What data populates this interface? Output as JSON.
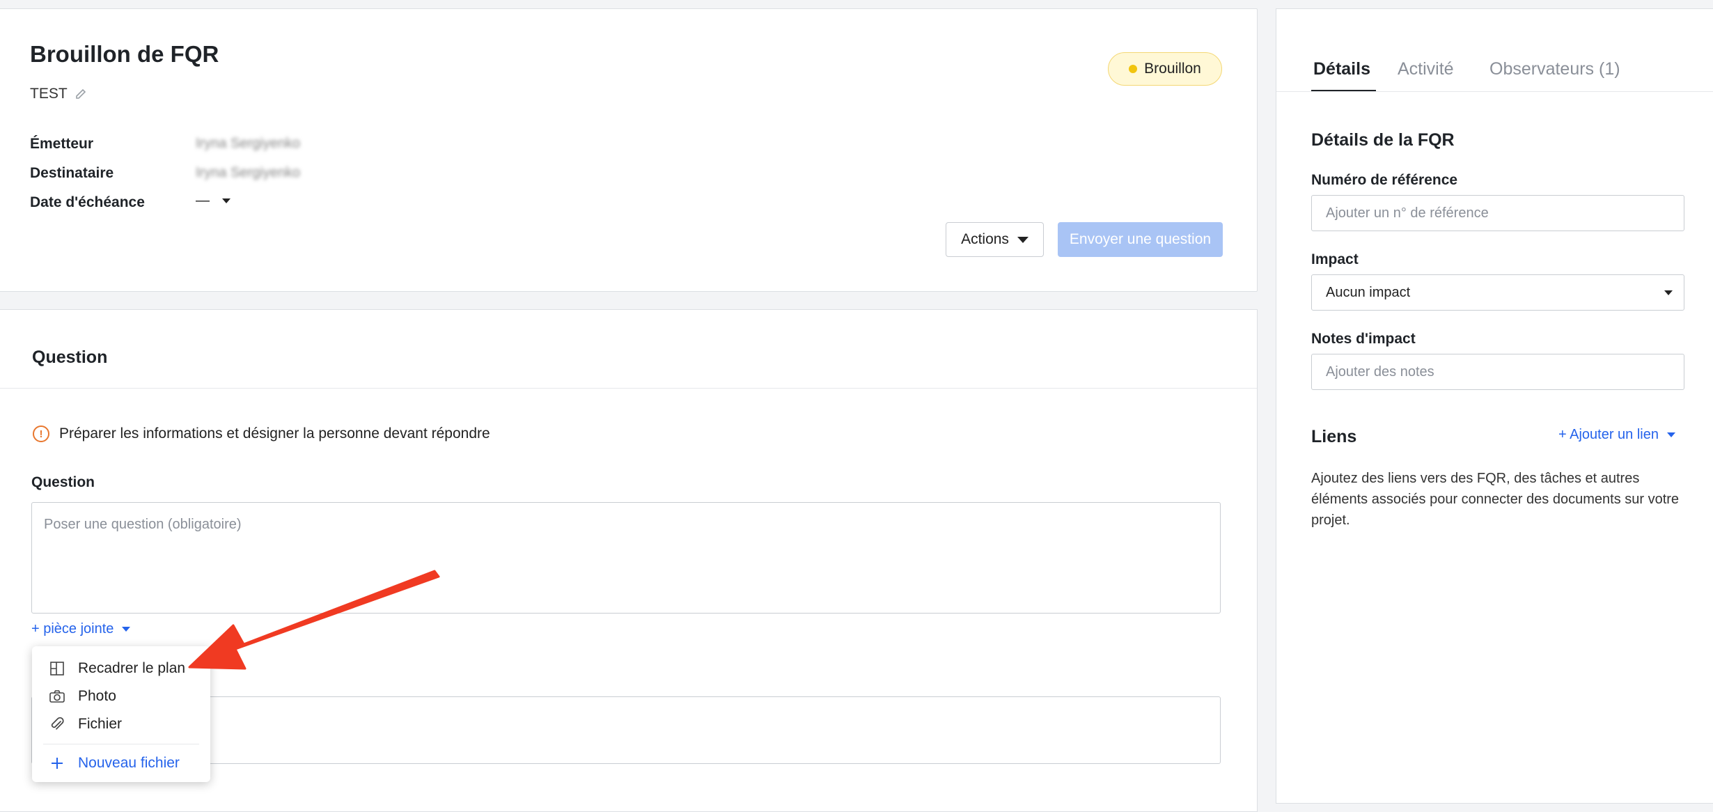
{
  "header": {
    "title": "Brouillon de FQR",
    "subtitle": "TEST",
    "status_label": "Brouillon",
    "fields": [
      {
        "label": "Émetteur",
        "value": "Iryna Sergiyenko"
      },
      {
        "label": "Destinataire",
        "value": "Iryna Sergiyenko"
      },
      {
        "label": "Date d'échéance",
        "value": "—"
      }
    ],
    "actions_label": "Actions",
    "send_label": "Envoyer une question"
  },
  "question": {
    "section_title": "Question",
    "warning": "Préparer les informations et désigner la personne devant répondre",
    "field_label": "Question",
    "placeholder": "Poser une question (obligatoire)",
    "attach_label": "+ pièce jointe"
  },
  "attach_menu": {
    "items": [
      "Recadrer le plan",
      "Photo",
      "Fichier"
    ],
    "new_file": "Nouveau fichier"
  },
  "sidebar": {
    "tabs": [
      "Détails",
      "Activité",
      "Observateurs (1)"
    ],
    "section_title": "Détails de la FQR",
    "reference": {
      "label": "Numéro de référence",
      "placeholder": "Ajouter un n° de référence"
    },
    "impact": {
      "label": "Impact",
      "value": "Aucun impact"
    },
    "impact_notes": {
      "label": "Notes d'impact",
      "placeholder": "Ajouter des notes"
    },
    "links": {
      "title": "Liens",
      "add_label": "+ Ajouter un lien",
      "help": "Ajoutez des liens vers des FQR, des tâches et autres éléments associés pour connecter des documents sur votre projet."
    }
  },
  "colors": {
    "accent": "#2563eb",
    "warning": "#e8772e",
    "arrow": "#f03a22",
    "badge_bg": "#fff8d6"
  }
}
